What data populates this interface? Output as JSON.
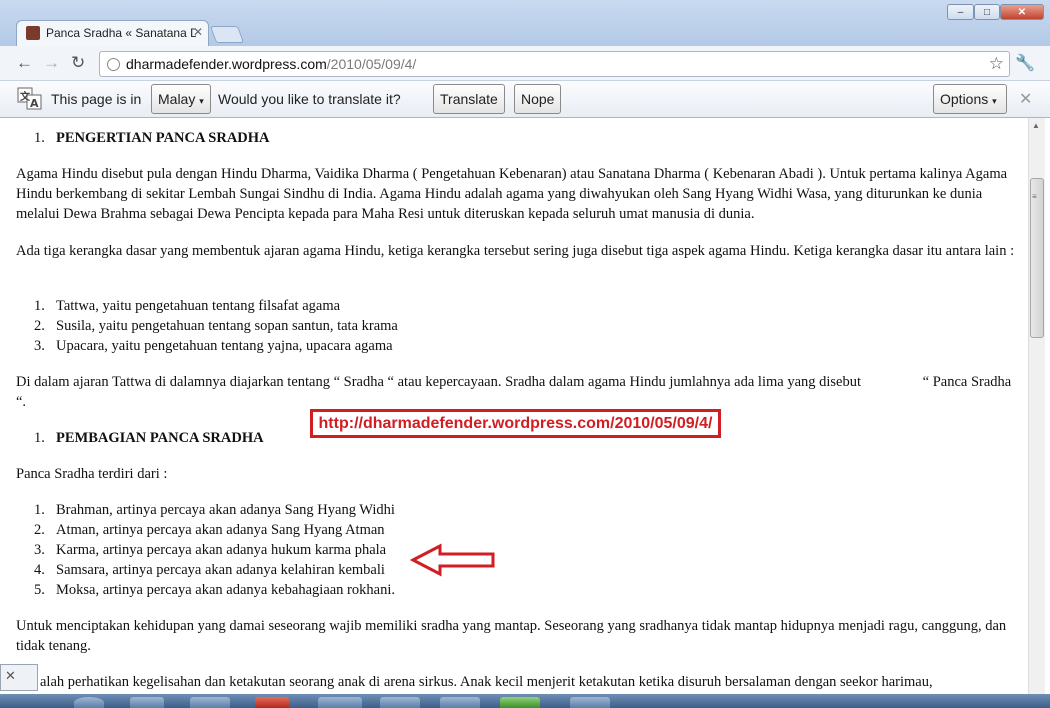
{
  "tab": {
    "title": "Panca Sradha « Sanatana D",
    "close": "✕"
  },
  "window": {
    "minimize": "–",
    "maximize": "□",
    "close": "✕"
  },
  "nav": {
    "back": "←",
    "forward": "→",
    "reload": "↻",
    "star": "☆",
    "wrench": "🔧"
  },
  "address": {
    "host": "dharmadefender.wordpress.com",
    "path": "/2010/05/09/4/"
  },
  "translate_bar": {
    "prefix": "This page is in",
    "language": "Malay",
    "question": "Would you like to translate it?",
    "translate_label": "Translate",
    "nope_label": "Nope",
    "options_label": "Options",
    "close": "✕"
  },
  "article": {
    "heading1_num": "1.",
    "heading1": "PENGERTIAN PANCA SRADHA",
    "para1": "Agama Hindu disebut pula dengan Hindu Dharma, Vaidika Dharma ( Pengetahuan Kebenaran) atau Sanatana Dharma ( Kebenaran Abadi ). Untuk pertama kalinya Agama Hindu berkembang di sekitar Lembah Sungai Sindhu di India. Agama Hindu adalah agama yang diwahyukan oleh Sang Hyang Widhi Wasa, yang diturunkan ke dunia melalui Dewa Brahma sebagai Dewa Pencipta kepada para Maha Resi untuk diteruskan kepada seluruh umat manusia di dunia.",
    "para2": "Ada tiga kerangka dasar yang membentuk ajaran agama Hindu, ketiga kerangka tersebut sering juga disebut tiga aspek agama Hindu. Ketiga kerangka dasar itu antara lain :",
    "list1": [
      {
        "num": "1.",
        "text": "Tattwa, yaitu pengetahuan tentang filsafat agama"
      },
      {
        "num": "2.",
        "text": "Susila, yaitu pengetahuan tentang sopan santun, tata krama"
      },
      {
        "num": "3.",
        "text": "Upacara, yaitu pengetahuan tentang yajna, upacara agama"
      }
    ],
    "para3": "Di dalam ajaran Tattwa di dalamnya diajarkan tentang “ Sradha “ atau kepercayaan. Sradha dalam agama Hindu jumlahnya ada lima yang disebut                 “ Panca Sradha “.",
    "heading2_num": "1.",
    "heading2": "PEMBAGIAN PANCA SRADHA",
    "para4": "Panca Sradha terdiri dari :",
    "list2": [
      {
        "num": "1.",
        "text": "Brahman, artinya percaya akan adanya Sang Hyang Widhi"
      },
      {
        "num": "2.",
        "text": "Atman, artinya percaya akan adanya Sang Hyang Atman"
      },
      {
        "num": "3.",
        "text": "Karma, artinya percaya akan adanya hukum karma phala"
      },
      {
        "num": "4.",
        "text": "Samsara, artinya percaya akan adanya kelahiran kembali"
      },
      {
        "num": "5.",
        "text": "Moksa, artinya percaya akan adanya kebahagiaan rokhani."
      }
    ],
    "para5": "Untuk menciptakan kehidupan yang damai seseorang wajib memiliki sradha yang mantap. Seseorang yang sradhanya tidak mantap hidupnya menjadi ragu, canggung, dan tidak tenang.",
    "para6": "alah perhatikan kegelisahan dan ketakutan seorang anak di arena sirkus. Anak kecil menjerit ketakutan ketika disuruh bersalaman dengan seekor harimau,"
  },
  "overlay": {
    "url": "http://dharmadefender.wordpress.com/2010/05/09/4/",
    "color": "#d01e22"
  },
  "popup": {
    "close": "✕"
  }
}
